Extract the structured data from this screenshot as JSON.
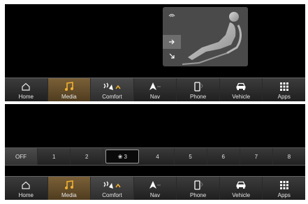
{
  "colors": {
    "accent": "#f0b030",
    "active_tab": "#6a5030",
    "background": "#000000",
    "bar": "#2e2e2e"
  },
  "seat_popup": {
    "modes": [
      {
        "icon": "fan-icon",
        "selected": false
      },
      {
        "icon": "arrow-right-icon",
        "selected": true
      },
      {
        "icon": "arrow-down-right-icon",
        "selected": false
      }
    ],
    "figure_icon": "seated-person-icon"
  },
  "nav": {
    "items": [
      {
        "label": "Home",
        "icon": "home-icon",
        "active": false
      },
      {
        "label": "Media",
        "icon": "music-note-icon",
        "active": true
      },
      {
        "label": "Comfort",
        "icon": "climate-icon",
        "active": false
      },
      {
        "label": "Nav",
        "icon": "navigation-arrow-icon",
        "active": false
      },
      {
        "label": "Phone",
        "icon": "phone-icon",
        "active": false
      },
      {
        "label": "Vehicle",
        "icon": "car-icon",
        "active": false
      },
      {
        "label": "Apps",
        "icon": "apps-grid-icon",
        "active": false
      }
    ]
  },
  "fan": {
    "off_label": "OFF",
    "levels": [
      "1",
      "2",
      "3",
      "4",
      "5",
      "6",
      "7",
      "8"
    ],
    "selected_level": "3",
    "selected_icon": "fan-icon"
  }
}
